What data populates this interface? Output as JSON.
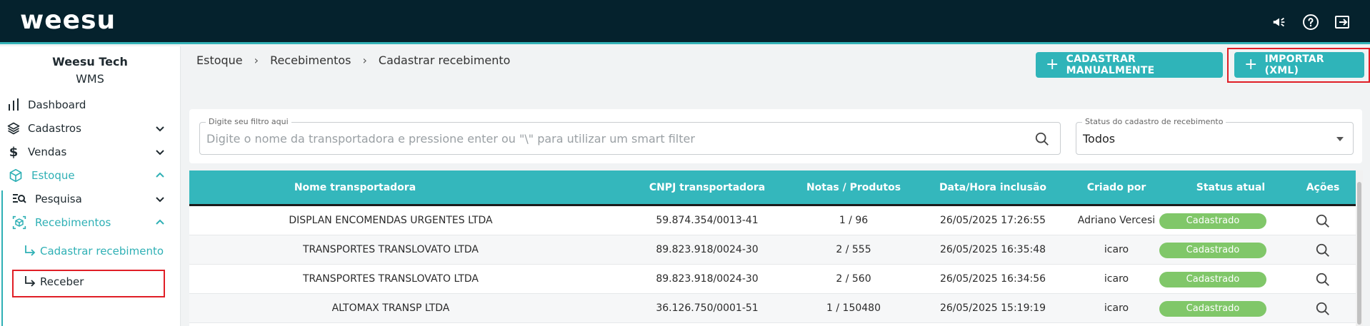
{
  "app": {
    "logo": "weesu"
  },
  "company": {
    "name": "Weesu Tech",
    "product": "WMS"
  },
  "sidebar": {
    "items": [
      {
        "label": "Dashboard",
        "icon": "bar-chart-icon"
      },
      {
        "label": "Cadastros",
        "icon": "layers-icon"
      },
      {
        "label": "Vendas",
        "icon": "dollar-icon"
      },
      {
        "label": "Estoque",
        "icon": "box-icon"
      },
      {
        "label": "Pesquisa",
        "icon": "search-list-icon"
      },
      {
        "label": "Recebimentos",
        "icon": "receive-box-icon"
      },
      {
        "label": "Cadastrar recebimento",
        "icon": "arrow-turn-icon"
      },
      {
        "label": "Receber",
        "icon": "arrow-turn-icon"
      }
    ]
  },
  "breadcrumb": [
    "Estoque",
    "Recebimentos",
    "Cadastrar recebimento"
  ],
  "actions": {
    "manual": "CADASTRAR MANUALMENTE",
    "import": "IMPORTAR (XML)"
  },
  "filter": {
    "label": "Digite seu filtro aqui",
    "placeholder": "Digite o nome da transportadora e pressione enter ou  \"\\\" para utilizar um smart filter",
    "status_label": "Status do cadastro de recebimento",
    "status_value": "Todos"
  },
  "table": {
    "headers": [
      "Nome transportadora",
      "CNPJ transportadora",
      "Notas / Produtos",
      "Data/Hora inclusão",
      "Criado por",
      "Status atual",
      "Ações"
    ],
    "rows": [
      {
        "name": "DISPLAN ENCOMENDAS URGENTES LTDA",
        "cnpj": "59.874.354/0013-41",
        "notas": "1 / 96",
        "data": "26/05/2025 17:26:55",
        "criado": "Adriano Vercesi",
        "status": "Cadastrado"
      },
      {
        "name": "TRANSPORTES TRANSLOVATO LTDA",
        "cnpj": "89.823.918/0024-30",
        "notas": "2 / 555",
        "data": "26/05/2025 16:35:48",
        "criado": "icaro",
        "status": "Cadastrado"
      },
      {
        "name": "TRANSPORTES TRANSLOVATO LTDA",
        "cnpj": "89.823.918/0024-30",
        "notas": "2 / 560",
        "data": "26/05/2025 16:34:56",
        "criado": "icaro",
        "status": "Cadastrado"
      },
      {
        "name": "ALTOMAX TRANSP LTDA",
        "cnpj": "36.126.750/0001-51",
        "notas": "1 / 150480",
        "data": "26/05/2025 15:19:19",
        "criado": "icaro",
        "status": "Cadastrado"
      }
    ]
  },
  "colors": {
    "topbar": "#05222d",
    "accent": "#2fb4b9",
    "status_ok": "#80c769",
    "highlight": "#e01e26"
  }
}
